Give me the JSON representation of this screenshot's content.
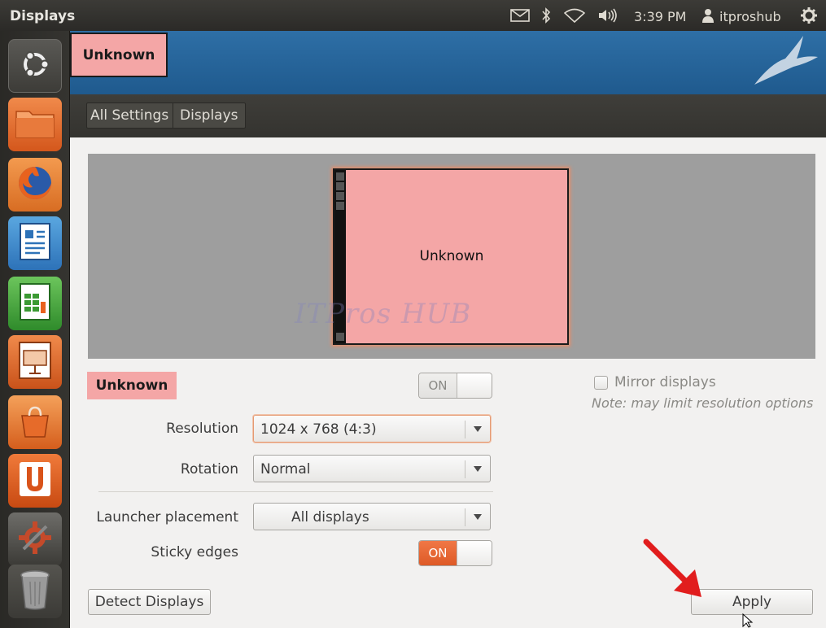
{
  "topbar": {
    "app_title": "Displays",
    "clock": "3:39 PM",
    "user": "itproshub",
    "icons": [
      "mail-icon",
      "bluetooth-icon",
      "wifi-icon",
      "volume-icon",
      "user-icon",
      "gear-icon"
    ]
  },
  "launcher": {
    "items": [
      {
        "name": "dash-home",
        "icon": "ubuntu-logo-icon"
      },
      {
        "name": "files",
        "icon": "folder-icon"
      },
      {
        "name": "firefox",
        "icon": "firefox-icon"
      },
      {
        "name": "libreoffice-writer",
        "icon": "writer-icon"
      },
      {
        "name": "libreoffice-calc",
        "icon": "calc-icon"
      },
      {
        "name": "libreoffice-impress",
        "icon": "impress-icon"
      },
      {
        "name": "software-center",
        "icon": "shopping-bag-icon"
      },
      {
        "name": "ubuntu-one",
        "icon": "ubuntu-one-icon"
      },
      {
        "name": "system-settings",
        "icon": "settings-icon"
      },
      {
        "name": "trash",
        "icon": "trash-icon"
      }
    ]
  },
  "window": {
    "title_tag": "Unknown",
    "breadcrumb": {
      "all_settings": "All Settings",
      "displays": "Displays"
    }
  },
  "monitor": {
    "label": "Unknown"
  },
  "watermark": "ITPros HUB",
  "display": {
    "name": "Unknown",
    "power_switch": "ON",
    "resolution_label": "Resolution",
    "resolution_value": "1024 x 768 (4:3)",
    "rotation_label": "Rotation",
    "rotation_value": "Normal",
    "launcher_label": "Launcher placement",
    "launcher_value": "All displays",
    "sticky_label": "Sticky edges",
    "sticky_switch": "ON"
  },
  "mirror": {
    "label": "Mirror displays",
    "note": "Note: may limit resolution options",
    "checked": false
  },
  "buttons": {
    "detect": "Detect Displays",
    "apply": "Apply"
  },
  "colors": {
    "accent": "#e0602c",
    "display_pink": "#f4a6a6",
    "annotation_red": "#e11d1d"
  }
}
